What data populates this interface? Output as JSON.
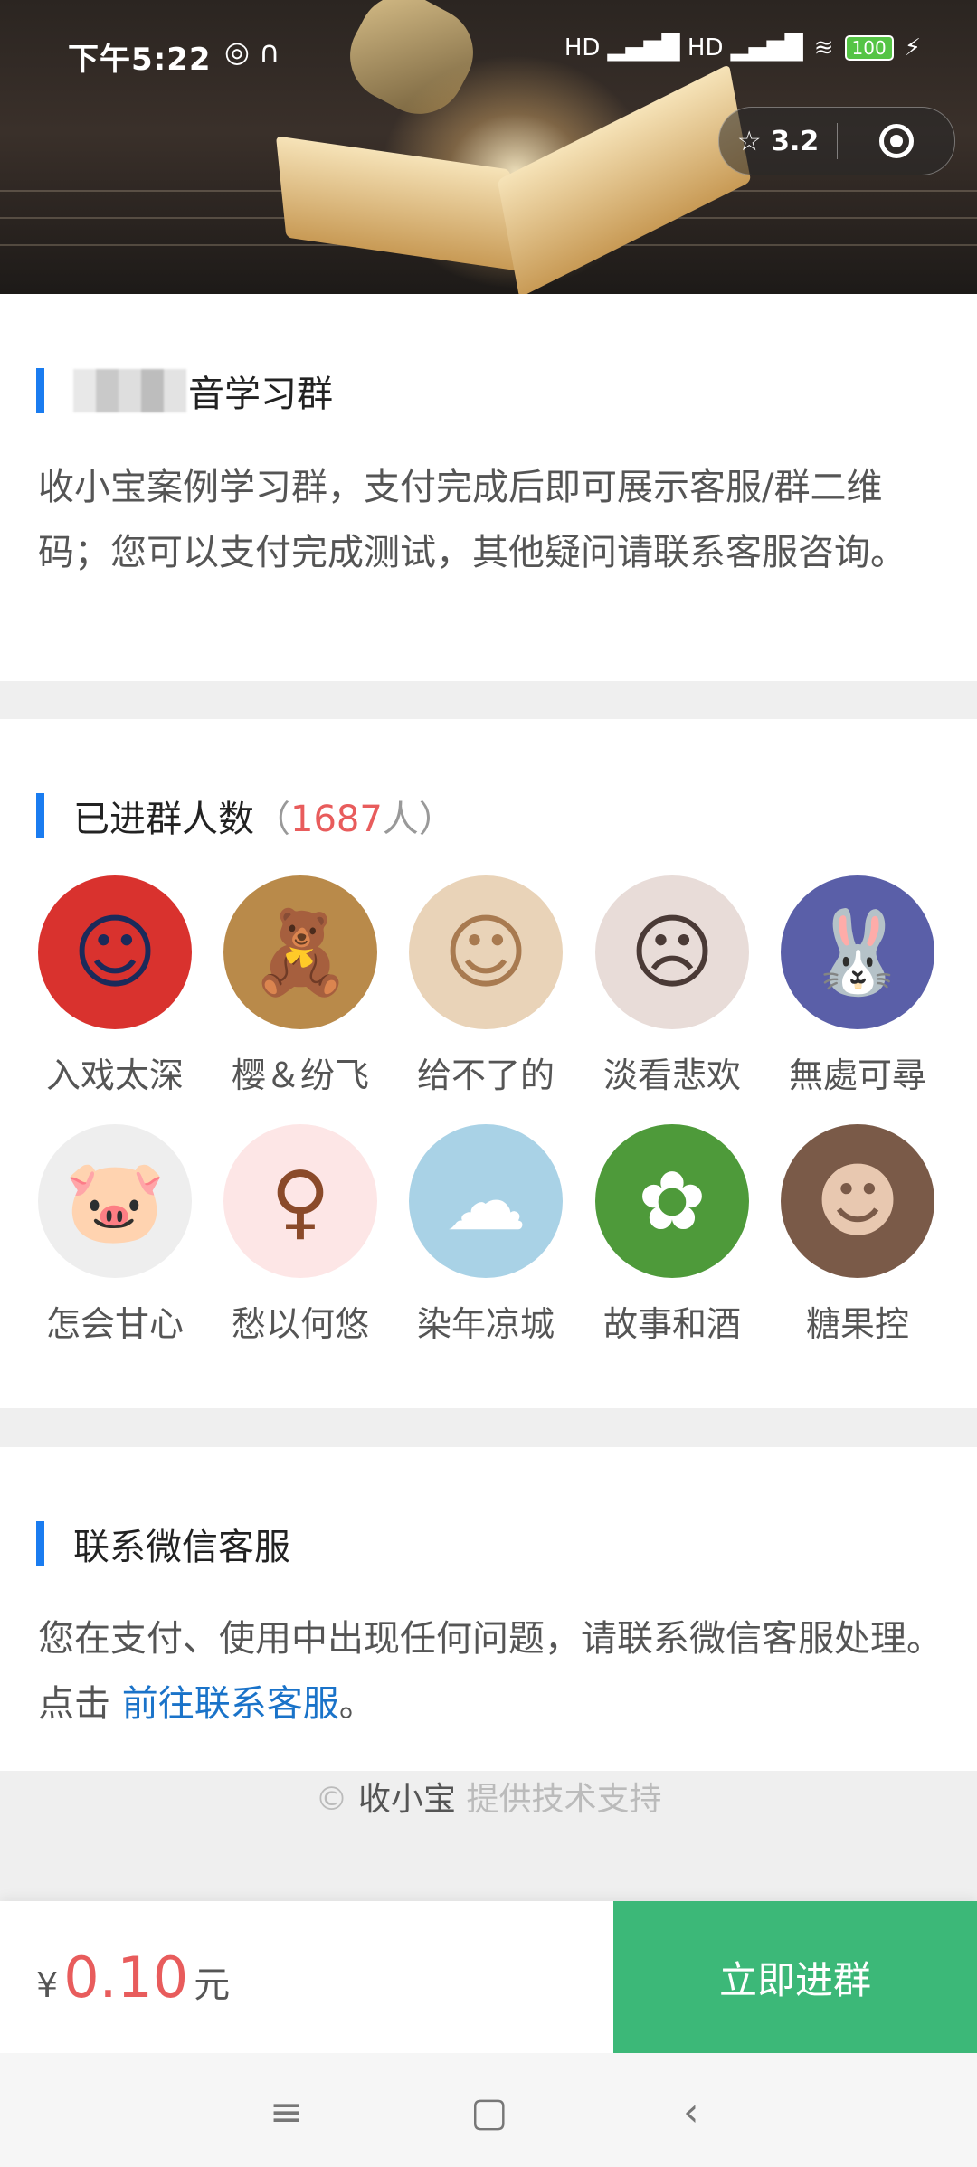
{
  "status_bar": {
    "time": "下午5:22",
    "left_icons": "◎ ∩",
    "signal": "HD ▂▄▆█  HD ▂▄▆█",
    "wifi": "≋",
    "battery": "100",
    "charging": "⚡"
  },
  "capsule": {
    "rating": "3.2",
    "star_icon": "star-icon",
    "target_icon": "target-icon"
  },
  "intro": {
    "title_suffix": "音学习群",
    "description": "收小宝案例学习群，支付完成后即可展示客服/群二维码；您可以支付完成测试，其他疑问请联系客服咨询。"
  },
  "members": {
    "label": "已进群人数",
    "count_open": "（",
    "count": "1687",
    "count_unit": "人）",
    "list": [
      {
        "name": "入戏太深",
        "bg": "#d9322e",
        "glyph": "☺",
        "color": "#1b2a5a"
      },
      {
        "name": "樱＆纷飞",
        "bg": "#b98a4a",
        "glyph": "🧸",
        "color": "#e8a93a"
      },
      {
        "name": "给不了的",
        "bg": "#e9d3b8",
        "glyph": "☺",
        "color": "#a87a50"
      },
      {
        "name": "淡看悲欢",
        "bg": "#e8dcd8",
        "glyph": "☹",
        "color": "#4a3a36"
      },
      {
        "name": "無處可尋",
        "bg": "#5a5fa8",
        "glyph": "🐰",
        "color": "#f2b8c0"
      },
      {
        "name": "怎会甘心",
        "bg": "#eeeeee",
        "glyph": "🐷",
        "color": "#e84040"
      },
      {
        "name": "愁以何悠",
        "bg": "#fde6e6",
        "glyph": "♀",
        "color": "#8a4a2a"
      },
      {
        "name": "染年凉城",
        "bg": "#a9d2e6",
        "glyph": "☁",
        "color": "#ffffff"
      },
      {
        "name": "故事和酒",
        "bg": "#4e9a3a",
        "glyph": "✿",
        "color": "#ffffff"
      },
      {
        "name": "糖果控",
        "bg": "#7a5a48",
        "glyph": "☻",
        "color": "#e8c8b0"
      }
    ]
  },
  "contact": {
    "title": "联系微信客服",
    "text_before": "您在支付、使用中出现任何问题，请联系微信客服处理。点击 ",
    "link": "前往联系客服",
    "text_after": "。"
  },
  "footer": {
    "copyright": "©",
    "brand": "收小宝",
    "suffix": "提供技术支持"
  },
  "pay": {
    "currency": "¥",
    "amount": "0.10",
    "unit": "元",
    "button": "立即进群"
  },
  "nav": {
    "menu": "≡",
    "home": "▢",
    "back": "‹"
  }
}
